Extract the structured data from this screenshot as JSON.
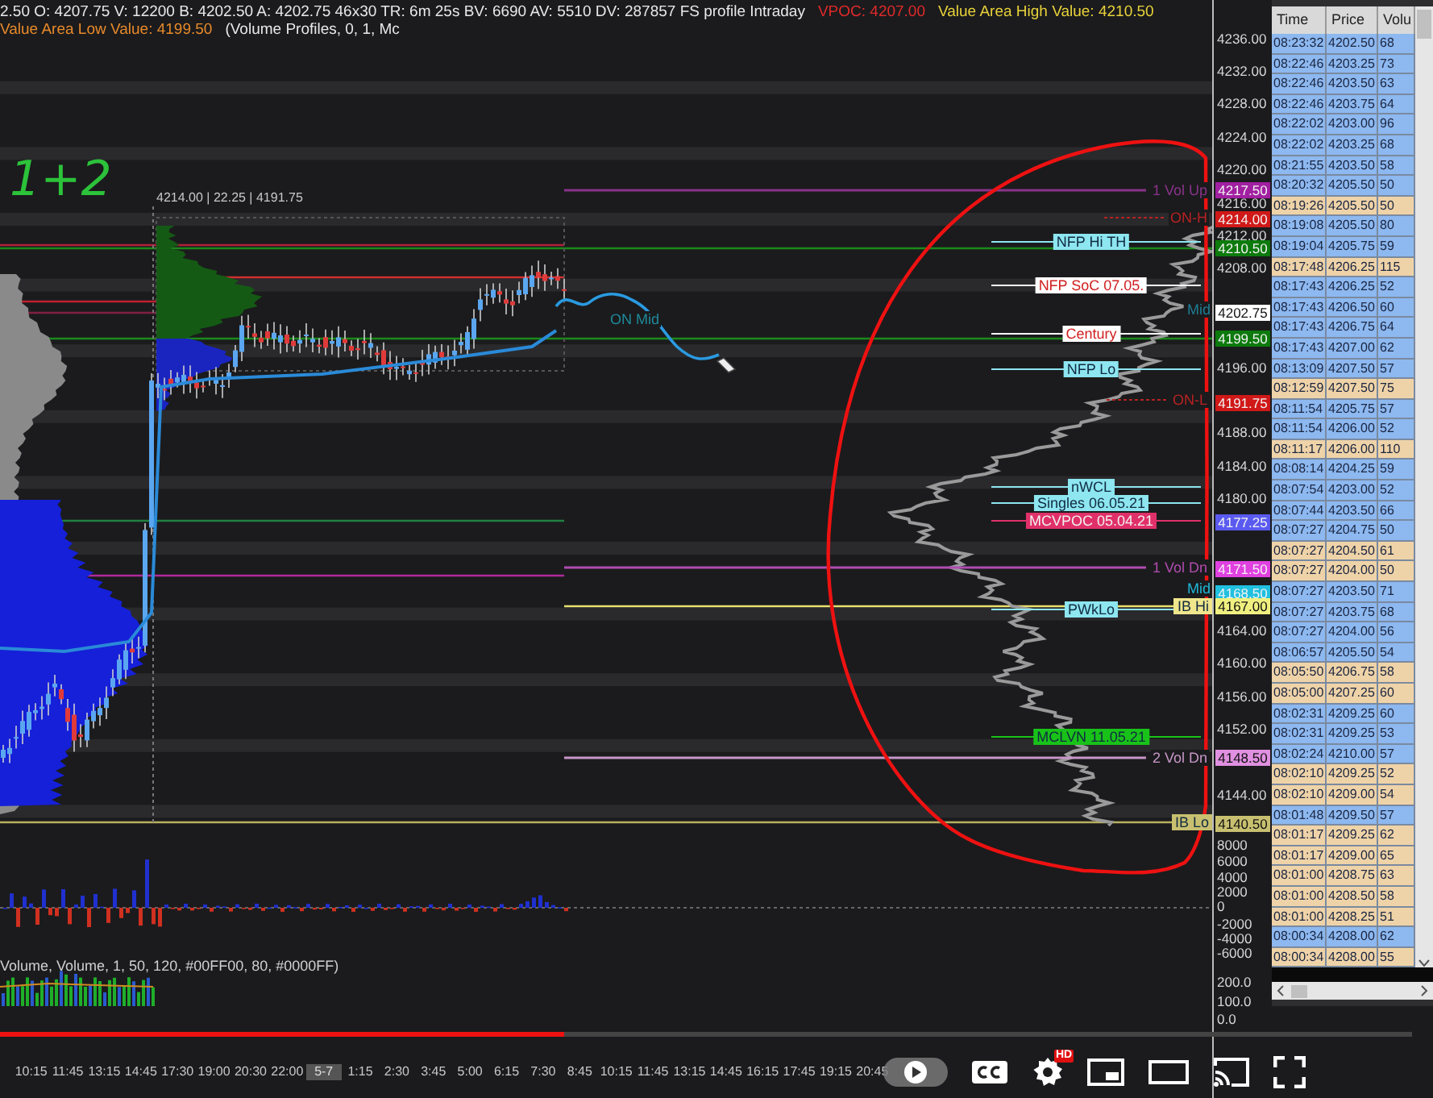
{
  "header": {
    "segments": [
      {
        "kind": "info",
        "text": "2.50 O: 4207.75 V: 12200 B: 4202.50 A: 4202.75 46x30 TR: 6m 25s BV: 6690 AV: 5510 DV: 287857 FS profile Intraday"
      },
      {
        "kind": "vpoc",
        "text": "VPOC: 4207.00"
      },
      {
        "kind": "vah",
        "text": "Value Area High Value: 4210.50"
      },
      {
        "kind": "val",
        "text": "Value Area Low Value: 4199.50"
      },
      {
        "kind": "info",
        "text": "(Volume Profiles, 0, 1, Mc"
      }
    ]
  },
  "annotation": {
    "text": "1+2"
  },
  "range_label": "4214.00 | 22.25 | 4191.75",
  "level_labels": [
    {
      "kind": "right",
      "text": "1 Vol Up",
      "color": "#8a338a"
    },
    {
      "kind": "dashed",
      "text": "ON-H",
      "color": "#b82222"
    },
    {
      "kind": "box",
      "text": "NFP Hi TH",
      "color": "#8de6f0"
    },
    {
      "kind": "box",
      "text": "NFP SoC 07.05.",
      "color": "#ffffff"
    },
    {
      "kind": "mid",
      "text": "Mid",
      "color": "#1e7f96"
    },
    {
      "kind": "mid",
      "text": "ON Mid",
      "color": "#1f8a9a"
    },
    {
      "kind": "box",
      "text": "Century",
      "color": "#ffffff"
    },
    {
      "kind": "box",
      "text": "NFP Lo",
      "color": "#8de6f0"
    },
    {
      "kind": "dashed",
      "text": "ON-L",
      "color": "#b82222"
    },
    {
      "kind": "box",
      "text": "nWCL",
      "color": "#8de6f0"
    },
    {
      "kind": "box",
      "text": "Singles 06.05.21",
      "color": "#8de6f0"
    },
    {
      "kind": "box",
      "text": "MCVPOC 05.04.21",
      "color": "#e0306a"
    },
    {
      "kind": "right",
      "text": "1 Vol Dn",
      "color": "#b04cb0"
    },
    {
      "kind": "mid",
      "text": "Mid",
      "color": "#20b8d8"
    },
    {
      "kind": "box",
      "text": "PWkLo",
      "color": "#8de6f0"
    },
    {
      "kind": "tagbox",
      "text": "IB Hi",
      "color": "#f0e68c"
    },
    {
      "kind": "box",
      "text": "MCLVN 11.05.21",
      "color": "#19c219"
    },
    {
      "kind": "right",
      "text": "2 Vol Dn",
      "color": "#c896c8"
    },
    {
      "kind": "tagbox",
      "text": "IB Lo",
      "color": "#c8c070"
    }
  ],
  "price_axis": {
    "ticks": [
      "4236.00",
      "4232.00",
      "4228.00",
      "4224.00",
      "4220.00",
      "4216.00",
      "4212.00",
      "4208.00",
      "4196.00",
      "4188.00",
      "4184.00",
      "4180.00",
      "4164.00",
      "4160.00",
      "4156.00",
      "4152.00",
      "4144.00"
    ],
    "tags": [
      {
        "text": "4217.50",
        "color": "#a11fa1"
      },
      {
        "text": "4214.00",
        "color": "#d01818"
      },
      {
        "text": "4210.50",
        "color": "#0c7a0c"
      },
      {
        "text": "4202.75",
        "color": "#ffffff"
      },
      {
        "text": "4199.50",
        "color": "#0c7a0c"
      },
      {
        "text": "4191.75",
        "color": "#d01818"
      },
      {
        "text": "4177.25",
        "color": "#5a5af0"
      },
      {
        "text": "4171.50",
        "color": "#e040e0"
      },
      {
        "text": "4168.50",
        "color": "#20c0e0"
      },
      {
        "text": "4167.00",
        "color": "#f0f080"
      },
      {
        "text": "4148.50",
        "color": "#e090e0"
      },
      {
        "text": "4140.50",
        "color": "#c8c070"
      }
    ]
  },
  "delta_axis": {
    "ticks": [
      "8000",
      "6000",
      "4000",
      "2000",
      "0",
      "-2000",
      "-4000",
      "-6000"
    ]
  },
  "volume_indicator": {
    "label": "Volume, Volume, 1, 50, 120, #00FF00, 80, #0000FF)",
    "ticks": [
      "200.0",
      "100.0",
      "0.0"
    ]
  },
  "time_axis": {
    "labels": [
      {
        "kind": "time",
        "text": "10:15"
      },
      {
        "kind": "time",
        "text": "11:45"
      },
      {
        "kind": "time",
        "text": "13:15"
      },
      {
        "kind": "time",
        "text": "14:45"
      },
      {
        "kind": "time",
        "text": "17:30"
      },
      {
        "kind": "time",
        "text": "19:00"
      },
      {
        "kind": "time",
        "text": "20:30"
      },
      {
        "kind": "time",
        "text": "22:00"
      },
      {
        "kind": "date",
        "text": "5-7"
      },
      {
        "kind": "time",
        "text": "1:15"
      },
      {
        "kind": "time",
        "text": "2:30"
      },
      {
        "kind": "time",
        "text": "3:45"
      },
      {
        "kind": "time",
        "text": "5:00"
      },
      {
        "kind": "time",
        "text": "6:15"
      },
      {
        "kind": "time",
        "text": "7:30"
      },
      {
        "kind": "time",
        "text": "8:45"
      },
      {
        "kind": "time",
        "text": "10:15"
      },
      {
        "kind": "time",
        "text": "11:45"
      },
      {
        "kind": "time",
        "text": "13:15"
      },
      {
        "kind": "time",
        "text": "14:45"
      },
      {
        "kind": "time",
        "text": "16:15"
      },
      {
        "kind": "time",
        "text": "17:45"
      },
      {
        "kind": "time",
        "text": "19:15"
      },
      {
        "kind": "time",
        "text": "20:45"
      }
    ]
  },
  "player": {
    "level": 0.4,
    "badge": "HD"
  },
  "time_and_sales": {
    "columns": [
      "Time",
      "Price",
      "Volu"
    ],
    "rows": [
      {
        "time": "08:23:32",
        "price": "4202.50",
        "volume": "68",
        "color": "#8db8f0"
      },
      {
        "time": "08:22:46",
        "price": "4203.25",
        "volume": "73",
        "color": "#8db8f0"
      },
      {
        "time": "08:22:46",
        "price": "4203.50",
        "volume": "63",
        "color": "#8db8f0"
      },
      {
        "time": "08:22:46",
        "price": "4203.75",
        "volume": "64",
        "color": "#8db8f0"
      },
      {
        "time": "08:22:02",
        "price": "4203.00",
        "volume": "96",
        "color": "#8db8f0"
      },
      {
        "time": "08:22:02",
        "price": "4203.25",
        "volume": "68",
        "color": "#8db8f0"
      },
      {
        "time": "08:21:55",
        "price": "4203.50",
        "volume": "58",
        "color": "#8db8f0"
      },
      {
        "time": "08:20:32",
        "price": "4205.50",
        "volume": "50",
        "color": "#8db8f0"
      },
      {
        "time": "08:19:26",
        "price": "4205.50",
        "volume": "50",
        "color": "#efd3a8"
      },
      {
        "time": "08:19:08",
        "price": "4205.50",
        "volume": "80",
        "color": "#8db8f0"
      },
      {
        "time": "08:19:04",
        "price": "4205.75",
        "volume": "59",
        "color": "#8db8f0"
      },
      {
        "time": "08:17:48",
        "price": "4206.25",
        "volume": "115",
        "color": "#efd3a8"
      },
      {
        "time": "08:17:43",
        "price": "4206.25",
        "volume": "52",
        "color": "#8db8f0"
      },
      {
        "time": "08:17:43",
        "price": "4206.50",
        "volume": "60",
        "color": "#8db8f0"
      },
      {
        "time": "08:17:43",
        "price": "4206.75",
        "volume": "64",
        "color": "#8db8f0"
      },
      {
        "time": "08:17:43",
        "price": "4207.00",
        "volume": "62",
        "color": "#8db8f0"
      },
      {
        "time": "08:13:09",
        "price": "4207.50",
        "volume": "57",
        "color": "#8db8f0"
      },
      {
        "time": "08:12:59",
        "price": "4207.50",
        "volume": "75",
        "color": "#efd3a8"
      },
      {
        "time": "08:11:54",
        "price": "4205.75",
        "volume": "57",
        "color": "#8db8f0"
      },
      {
        "time": "08:11:54",
        "price": "4206.00",
        "volume": "52",
        "color": "#8db8f0"
      },
      {
        "time": "08:11:17",
        "price": "4206.00",
        "volume": "110",
        "color": "#efd3a8"
      },
      {
        "time": "08:08:14",
        "price": "4204.25",
        "volume": "59",
        "color": "#8db8f0"
      },
      {
        "time": "08:07:54",
        "price": "4203.00",
        "volume": "52",
        "color": "#8db8f0"
      },
      {
        "time": "08:07:44",
        "price": "4203.50",
        "volume": "66",
        "color": "#8db8f0"
      },
      {
        "time": "08:07:27",
        "price": "4204.75",
        "volume": "50",
        "color": "#8db8f0"
      },
      {
        "time": "08:07:27",
        "price": "4204.50",
        "volume": "61",
        "color": "#efd3a8"
      },
      {
        "time": "08:07:27",
        "price": "4204.00",
        "volume": "50",
        "color": "#efd3a8"
      },
      {
        "time": "08:07:27",
        "price": "4203.50",
        "volume": "71",
        "color": "#8db8f0"
      },
      {
        "time": "08:07:27",
        "price": "4203.75",
        "volume": "68",
        "color": "#8db8f0"
      },
      {
        "time": "08:07:27",
        "price": "4204.00",
        "volume": "56",
        "color": "#8db8f0"
      },
      {
        "time": "08:06:57",
        "price": "4205.50",
        "volume": "54",
        "color": "#8db8f0"
      },
      {
        "time": "08:05:50",
        "price": "4206.75",
        "volume": "58",
        "color": "#efd3a8"
      },
      {
        "time": "08:05:00",
        "price": "4207.25",
        "volume": "60",
        "color": "#efd3a8"
      },
      {
        "time": "08:02:31",
        "price": "4209.25",
        "volume": "60",
        "color": "#8db8f0"
      },
      {
        "time": "08:02:31",
        "price": "4209.25",
        "volume": "53",
        "color": "#8db8f0"
      },
      {
        "time": "08:02:24",
        "price": "4210.00",
        "volume": "57",
        "color": "#8db8f0"
      },
      {
        "time": "08:02:10",
        "price": "4209.25",
        "volume": "52",
        "color": "#efd3a8"
      },
      {
        "time": "08:02:10",
        "price": "4209.00",
        "volume": "54",
        "color": "#efd3a8"
      },
      {
        "time": "08:01:48",
        "price": "4209.50",
        "volume": "57",
        "color": "#8db8f0"
      },
      {
        "time": "08:01:17",
        "price": "4209.25",
        "volume": "62",
        "color": "#efd3a8"
      },
      {
        "time": "08:01:17",
        "price": "4209.00",
        "volume": "65",
        "color": "#efd3a8"
      },
      {
        "time": "08:01:00",
        "price": "4208.75",
        "volume": "63",
        "color": "#efd3a8"
      },
      {
        "time": "08:01:00",
        "price": "4208.50",
        "volume": "58",
        "color": "#efd3a8"
      },
      {
        "time": "08:01:00",
        "price": "4208.25",
        "volume": "51",
        "color": "#efd3a8"
      },
      {
        "time": "08:00:34",
        "price": "4208.00",
        "volume": "62",
        "color": "#8db8f0"
      },
      {
        "time": "08:00:34",
        "price": "4208.00",
        "volume": "55",
        "color": "#efd3a8"
      }
    ]
  }
}
